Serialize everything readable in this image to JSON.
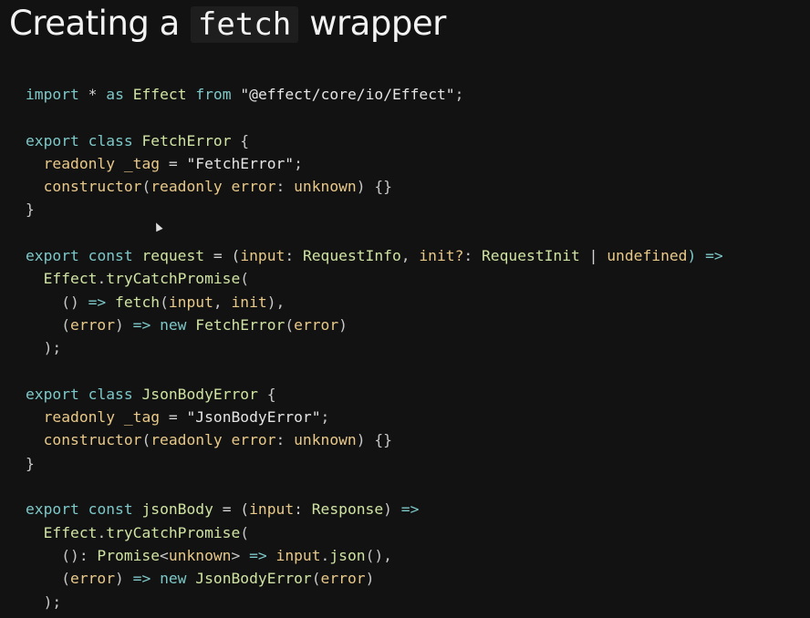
{
  "title": {
    "prefix": "Creating a",
    "code": "fetch",
    "suffix": "wrapper"
  },
  "code_lines": [
    [
      {
        "t": "import",
        "c": "kw"
      },
      {
        "t": " ",
        "c": "punc"
      },
      {
        "t": "*",
        "c": "op"
      },
      {
        "t": " ",
        "c": "punc"
      },
      {
        "t": "as",
        "c": "kw"
      },
      {
        "t": " ",
        "c": "punc"
      },
      {
        "t": "Effect",
        "c": "ty"
      },
      {
        "t": " ",
        "c": "punc"
      },
      {
        "t": "from",
        "c": "kw"
      },
      {
        "t": " ",
        "c": "punc"
      },
      {
        "t": "\"@effect/core/io/Effect\"",
        "c": "str"
      },
      {
        "t": ";",
        "c": "punc"
      }
    ],
    [],
    [
      {
        "t": "export",
        "c": "kw"
      },
      {
        "t": " ",
        "c": "punc"
      },
      {
        "t": "class",
        "c": "kw"
      },
      {
        "t": " ",
        "c": "punc"
      },
      {
        "t": "FetchError",
        "c": "ty"
      },
      {
        "t": " {",
        "c": "punc"
      }
    ],
    [
      {
        "t": "  ",
        "c": "punc"
      },
      {
        "t": "readonly",
        "c": "pr"
      },
      {
        "t": " ",
        "c": "punc"
      },
      {
        "t": "_tag",
        "c": "id"
      },
      {
        "t": " = ",
        "c": "op"
      },
      {
        "t": "\"FetchError\"",
        "c": "str"
      },
      {
        "t": ";",
        "c": "punc"
      }
    ],
    [
      {
        "t": "  ",
        "c": "punc"
      },
      {
        "t": "constructor",
        "c": "pr"
      },
      {
        "t": "(",
        "c": "punc"
      },
      {
        "t": "readonly",
        "c": "pr"
      },
      {
        "t": " ",
        "c": "punc"
      },
      {
        "t": "error",
        "c": "id"
      },
      {
        "t": ": ",
        "c": "punc"
      },
      {
        "t": "unknown",
        "c": "pr"
      },
      {
        "t": ") {}",
        "c": "punc"
      }
    ],
    [
      {
        "t": "}",
        "c": "punc"
      }
    ],
    [],
    [
      {
        "t": "export",
        "c": "kw"
      },
      {
        "t": " ",
        "c": "punc"
      },
      {
        "t": "const",
        "c": "kw"
      },
      {
        "t": " ",
        "c": "punc"
      },
      {
        "t": "request",
        "c": "fn"
      },
      {
        "t": " = (",
        "c": "op"
      },
      {
        "t": "input",
        "c": "id"
      },
      {
        "t": ": ",
        "c": "punc"
      },
      {
        "t": "RequestInfo",
        "c": "ty"
      },
      {
        "t": ", ",
        "c": "punc"
      },
      {
        "t": "init?",
        "c": "id"
      },
      {
        "t": ": ",
        "c": "punc"
      },
      {
        "t": "RequestInit",
        "c": "ty"
      },
      {
        "t": " | ",
        "c": "op"
      },
      {
        "t": "undefined",
        "c": "pr"
      },
      {
        "t": ") =>",
        "c": "kw"
      }
    ],
    [
      {
        "t": "  ",
        "c": "punc"
      },
      {
        "t": "Effect",
        "c": "ty"
      },
      {
        "t": ".",
        "c": "punc"
      },
      {
        "t": "tryCatchPromise",
        "c": "fn"
      },
      {
        "t": "(",
        "c": "punc"
      }
    ],
    [
      {
        "t": "    () ",
        "c": "punc"
      },
      {
        "t": "=>",
        "c": "kw"
      },
      {
        "t": " ",
        "c": "punc"
      },
      {
        "t": "fetch",
        "c": "fn"
      },
      {
        "t": "(",
        "c": "punc"
      },
      {
        "t": "input",
        "c": "id"
      },
      {
        "t": ", ",
        "c": "punc"
      },
      {
        "t": "init",
        "c": "id"
      },
      {
        "t": "),",
        "c": "punc"
      }
    ],
    [
      {
        "t": "    (",
        "c": "punc"
      },
      {
        "t": "error",
        "c": "id"
      },
      {
        "t": ") ",
        "c": "punc"
      },
      {
        "t": "=>",
        "c": "kw"
      },
      {
        "t": " ",
        "c": "punc"
      },
      {
        "t": "new",
        "c": "kw"
      },
      {
        "t": " ",
        "c": "punc"
      },
      {
        "t": "FetchError",
        "c": "ty"
      },
      {
        "t": "(",
        "c": "punc"
      },
      {
        "t": "error",
        "c": "id"
      },
      {
        "t": ")",
        "c": "punc"
      }
    ],
    [
      {
        "t": "  );",
        "c": "punc"
      }
    ],
    [],
    [
      {
        "t": "export",
        "c": "kw"
      },
      {
        "t": " ",
        "c": "punc"
      },
      {
        "t": "class",
        "c": "kw"
      },
      {
        "t": " ",
        "c": "punc"
      },
      {
        "t": "JsonBodyError",
        "c": "ty"
      },
      {
        "t": " {",
        "c": "punc"
      }
    ],
    [
      {
        "t": "  ",
        "c": "punc"
      },
      {
        "t": "readonly",
        "c": "pr"
      },
      {
        "t": " ",
        "c": "punc"
      },
      {
        "t": "_tag",
        "c": "id"
      },
      {
        "t": " = ",
        "c": "op"
      },
      {
        "t": "\"JsonBodyError\"",
        "c": "str"
      },
      {
        "t": ";",
        "c": "punc"
      }
    ],
    [
      {
        "t": "  ",
        "c": "punc"
      },
      {
        "t": "constructor",
        "c": "pr"
      },
      {
        "t": "(",
        "c": "punc"
      },
      {
        "t": "readonly",
        "c": "pr"
      },
      {
        "t": " ",
        "c": "punc"
      },
      {
        "t": "error",
        "c": "id"
      },
      {
        "t": ": ",
        "c": "punc"
      },
      {
        "t": "unknown",
        "c": "pr"
      },
      {
        "t": ") {}",
        "c": "punc"
      }
    ],
    [
      {
        "t": "}",
        "c": "punc"
      }
    ],
    [],
    [
      {
        "t": "export",
        "c": "kw"
      },
      {
        "t": " ",
        "c": "punc"
      },
      {
        "t": "const",
        "c": "kw"
      },
      {
        "t": " ",
        "c": "punc"
      },
      {
        "t": "jsonBody",
        "c": "fn"
      },
      {
        "t": " = (",
        "c": "op"
      },
      {
        "t": "input",
        "c": "id"
      },
      {
        "t": ": ",
        "c": "punc"
      },
      {
        "t": "Response",
        "c": "ty"
      },
      {
        "t": ") ",
        "c": "punc"
      },
      {
        "t": "=>",
        "c": "kw"
      }
    ],
    [
      {
        "t": "  ",
        "c": "punc"
      },
      {
        "t": "Effect",
        "c": "ty"
      },
      {
        "t": ".",
        "c": "punc"
      },
      {
        "t": "tryCatchPromise",
        "c": "fn"
      },
      {
        "t": "(",
        "c": "punc"
      }
    ],
    [
      {
        "t": "    (): ",
        "c": "punc"
      },
      {
        "t": "Promise",
        "c": "ty"
      },
      {
        "t": "<",
        "c": "punc"
      },
      {
        "t": "unknown",
        "c": "pr"
      },
      {
        "t": "> ",
        "c": "punc"
      },
      {
        "t": "=>",
        "c": "kw"
      },
      {
        "t": " ",
        "c": "punc"
      },
      {
        "t": "input",
        "c": "id"
      },
      {
        "t": ".",
        "c": "punc"
      },
      {
        "t": "json",
        "c": "fn"
      },
      {
        "t": "(),",
        "c": "punc"
      }
    ],
    [
      {
        "t": "    (",
        "c": "punc"
      },
      {
        "t": "error",
        "c": "id"
      },
      {
        "t": ") ",
        "c": "punc"
      },
      {
        "t": "=>",
        "c": "kw"
      },
      {
        "t": " ",
        "c": "punc"
      },
      {
        "t": "new",
        "c": "kw"
      },
      {
        "t": " ",
        "c": "punc"
      },
      {
        "t": "JsonBodyError",
        "c": "ty"
      },
      {
        "t": "(",
        "c": "punc"
      },
      {
        "t": "error",
        "c": "id"
      },
      {
        "t": ")",
        "c": "punc"
      }
    ],
    [
      {
        "t": "  );",
        "c": "punc"
      }
    ]
  ]
}
